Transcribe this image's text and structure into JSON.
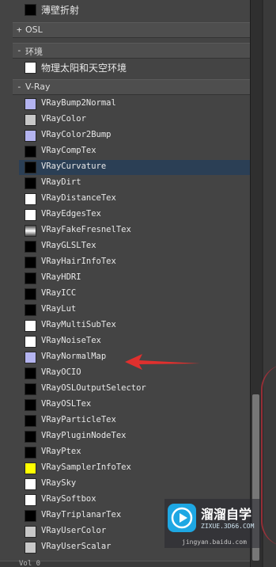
{
  "top_item": {
    "label": "薄壁折射",
    "color": "#000000"
  },
  "sections": {
    "osl": {
      "toggle": "+",
      "title": "OSL"
    },
    "environment": {
      "toggle": "-",
      "title": "环境",
      "items": [
        {
          "label": "物理太阳和天空环境",
          "color": "#ffffff"
        }
      ]
    },
    "vray": {
      "toggle": "-",
      "title": "V-Ray"
    }
  },
  "vray_items": [
    {
      "label": "VRayBump2Normal",
      "color": "#b4b4f0"
    },
    {
      "label": "VRayColor",
      "color": "#c8c8c8"
    },
    {
      "label": "VRayColor2Bump",
      "color": "#b4b4f0"
    },
    {
      "label": "VRayCompTex",
      "color": "#000000"
    },
    {
      "label": "VRayCurvature",
      "color": "#000000",
      "selected": true
    },
    {
      "label": "VRayDirt",
      "color": "#000000"
    },
    {
      "label": "VRayDistanceTex",
      "color": "#ffffff"
    },
    {
      "label": "VRayEdgesTex",
      "color": "#ffffff"
    },
    {
      "label": "VRayFakeFresnelTex",
      "color": "gradient"
    },
    {
      "label": "VRayGLSLTex",
      "color": "#000000"
    },
    {
      "label": "VRayHairInfoTex",
      "color": "#000000"
    },
    {
      "label": "VRayHDRI",
      "color": "#000000"
    },
    {
      "label": "VRayICC",
      "color": "#000000"
    },
    {
      "label": "VRayLut",
      "color": "#000000"
    },
    {
      "label": "VRayMultiSubTex",
      "color": "#ffffff"
    },
    {
      "label": "VRayNoiseTex",
      "color": "#ffffff"
    },
    {
      "label": "VRayNormalMap",
      "color": "#b4b4f0"
    },
    {
      "label": "VRayOCIO",
      "color": "#000000"
    },
    {
      "label": "VRayOSLOutputSelector",
      "color": "#000000"
    },
    {
      "label": "VRayOSLTex",
      "color": "#000000"
    },
    {
      "label": "VRayParticleTex",
      "color": "#000000"
    },
    {
      "label": "VRayPluginNodeTex",
      "color": "#000000"
    },
    {
      "label": "VRayPtex",
      "color": "#000000"
    },
    {
      "label": "VRaySamplerInfoTex",
      "color": "#ffff00"
    },
    {
      "label": "VRaySky",
      "color": "#ffffff"
    },
    {
      "label": "VRaySoftbox",
      "color": "#ffffff"
    },
    {
      "label": "VRayTriplanarTex",
      "color": "#000000"
    },
    {
      "label": "VRayUserColor",
      "color": "#c8c8c8"
    },
    {
      "label": "VRayUserScalar",
      "color": "#c8c8c8"
    }
  ],
  "watermark": {
    "title": "溜溜自学",
    "url": "ZIXUE.3D66.COM",
    "site": "jingyan.baidu.com"
  },
  "bottom_partial": "Vol 0"
}
